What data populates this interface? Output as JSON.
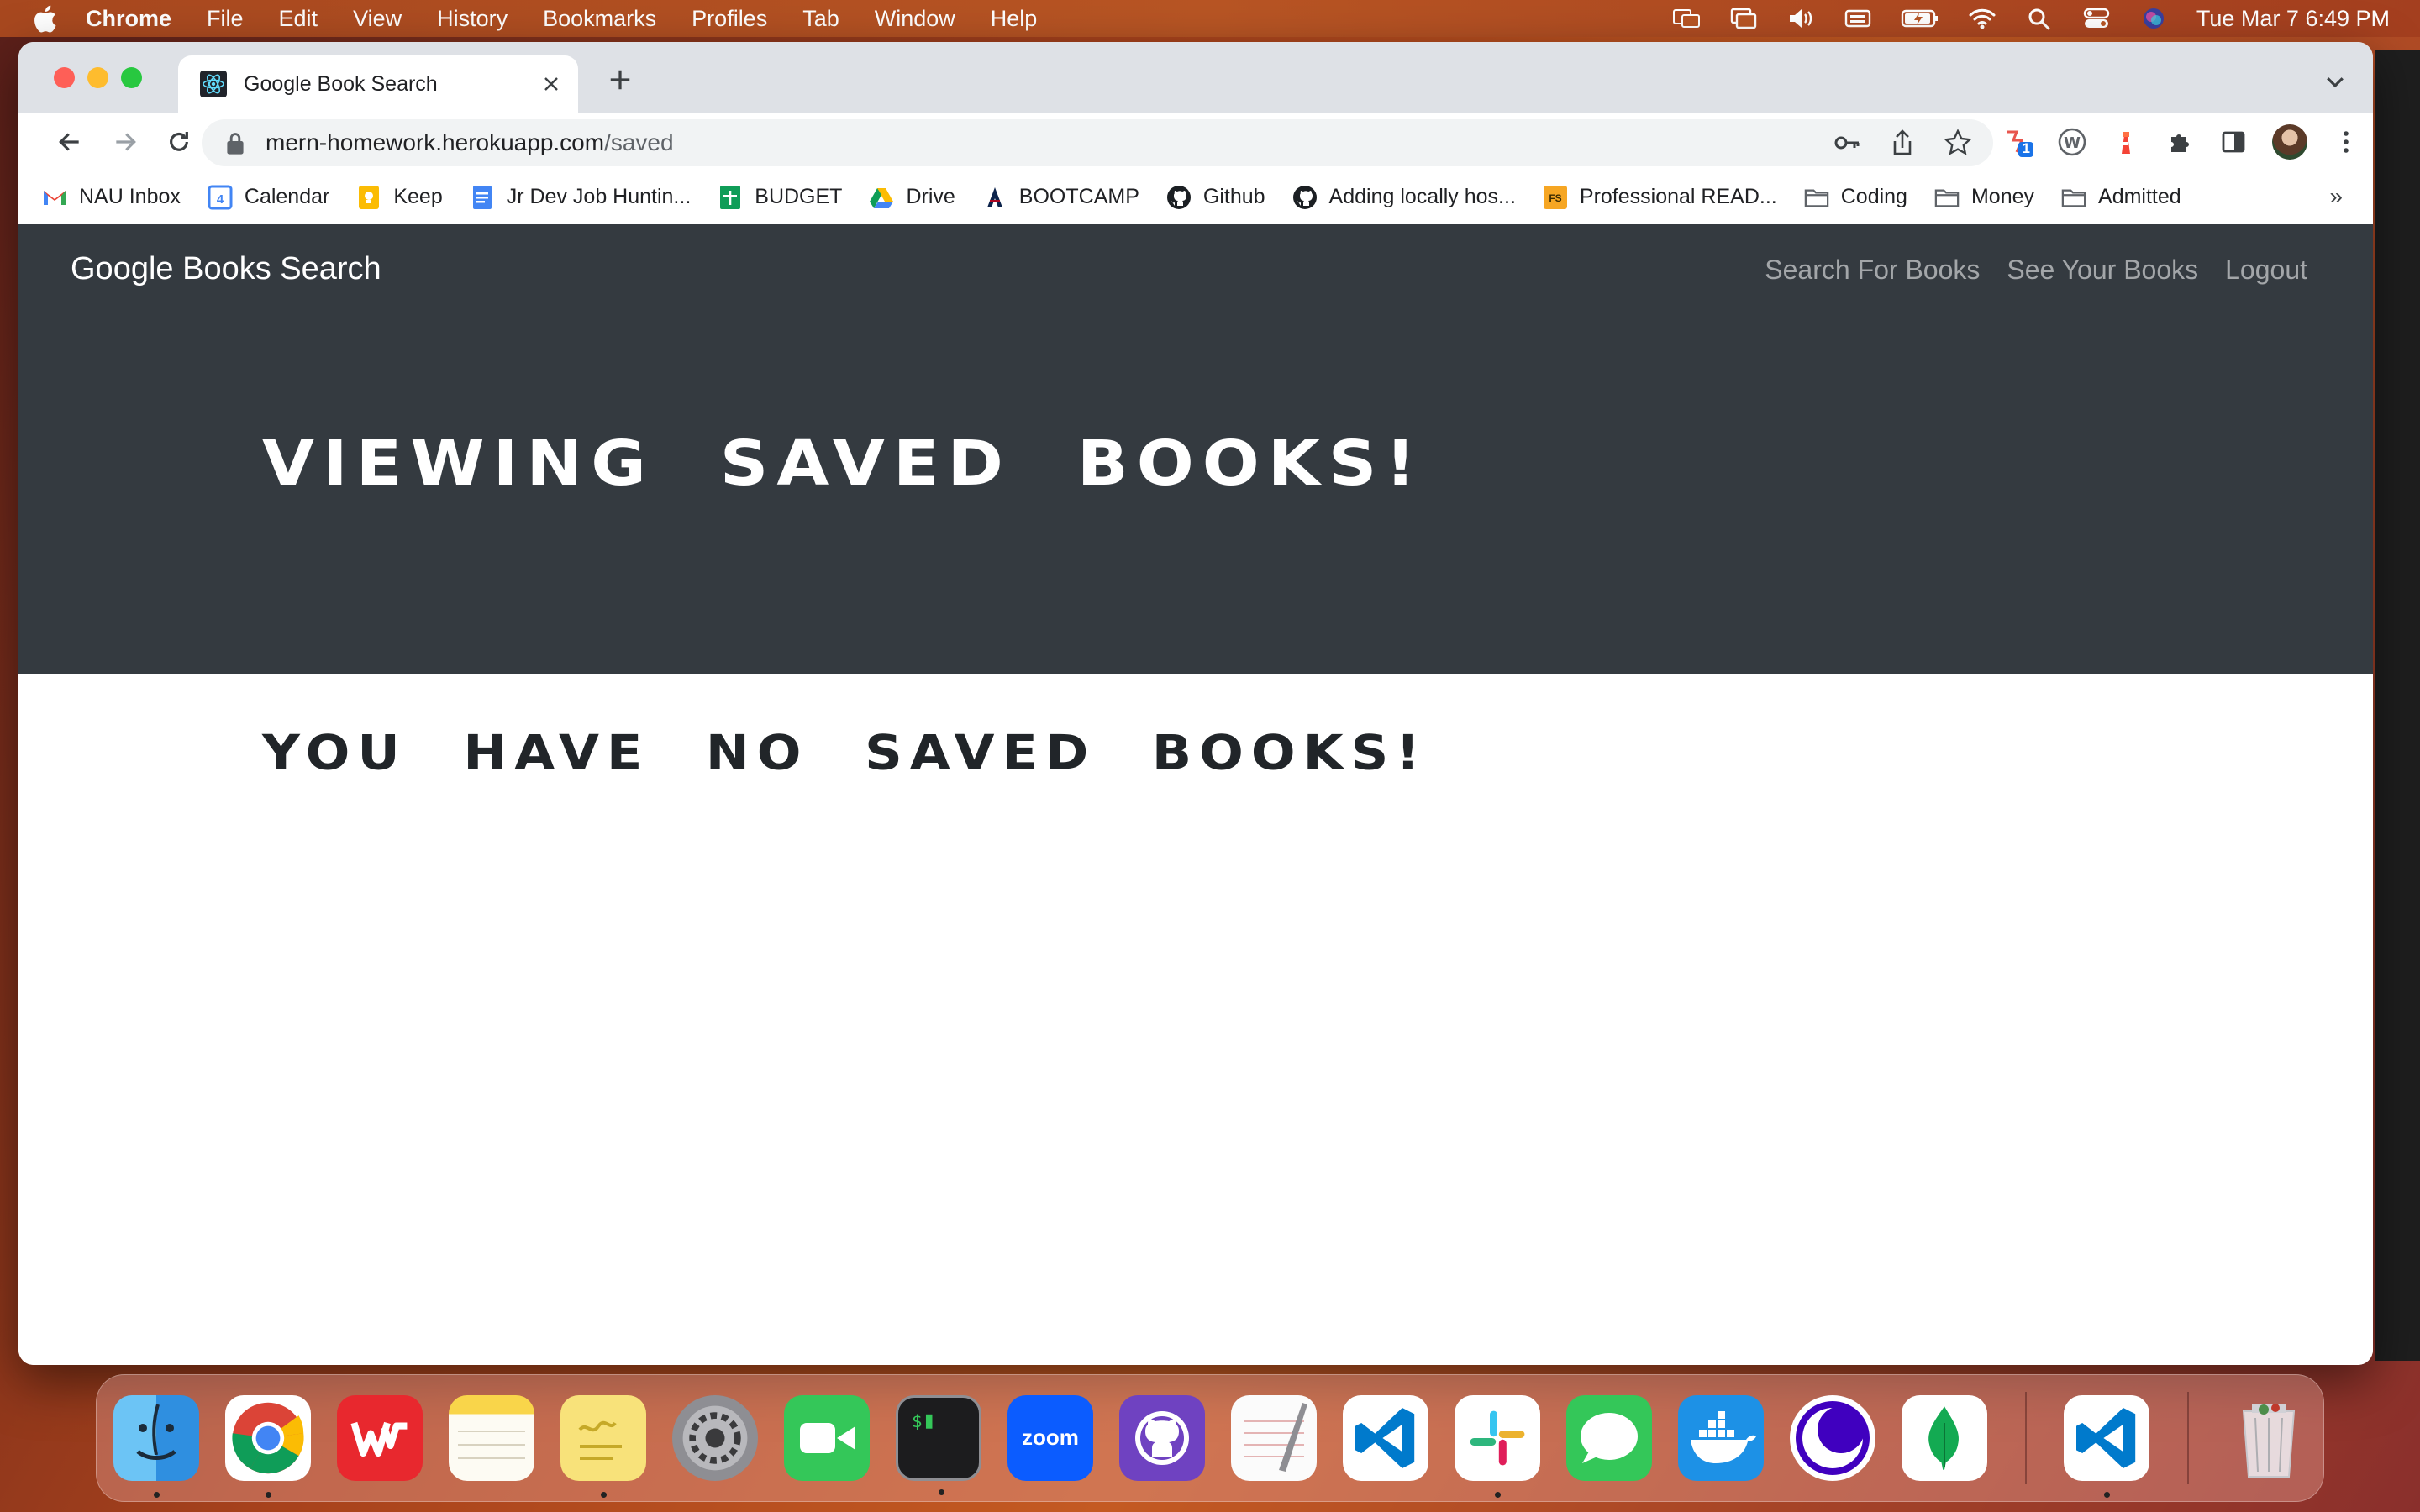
{
  "menubar": {
    "app_name": "Chrome",
    "items": [
      "File",
      "Edit",
      "View",
      "History",
      "Bookmarks",
      "Profiles",
      "Tab",
      "Window",
      "Help"
    ],
    "clock": "Tue Mar 7  6:49 PM"
  },
  "browser": {
    "tab_title": "Google Book Search",
    "url_host": "mern-homework.herokuapp.com",
    "url_path": "/saved",
    "bookmarks": [
      {
        "label": "NAU Inbox",
        "icon": "gmail-icon"
      },
      {
        "label": "Calendar",
        "icon": "calendar-icon"
      },
      {
        "label": "Keep",
        "icon": "keep-icon"
      },
      {
        "label": "Jr Dev Job Huntin...",
        "icon": "docs-icon"
      },
      {
        "label": "BUDGET",
        "icon": "sheets-icon"
      },
      {
        "label": "Drive",
        "icon": "drive-icon"
      },
      {
        "label": "BOOTCAMP",
        "icon": "arizona-icon"
      },
      {
        "label": "Github",
        "icon": "github-icon"
      },
      {
        "label": "Adding locally hos...",
        "icon": "github-icon"
      },
      {
        "label": "Professional READ...",
        "icon": "fs-icon"
      },
      {
        "label": "Coding",
        "icon": "folder-icon"
      },
      {
        "label": "Money",
        "icon": "folder-icon"
      },
      {
        "label": "Admitted",
        "icon": "folder-icon"
      }
    ],
    "bookmarks_more": "»",
    "extension_badge": "1"
  },
  "app": {
    "brand": "Google Books Search",
    "nav": {
      "search": "Search For Books",
      "saved": "See Your Books",
      "logout": "Logout"
    },
    "jumbotron_title": "Viewing saved books!",
    "empty_message": "You have no saved books!"
  },
  "dock": {
    "apps": [
      "Finder",
      "Chrome",
      "WPS Office",
      "Notes",
      "Stickies",
      "System Preferences",
      "FaceTime",
      "Terminal",
      "Zoom",
      "GitHub Desktop",
      "TextEdit",
      "VS Code",
      "Slack",
      "Messages",
      "Docker",
      "Insomnia",
      "MongoDB Compass",
      "VS Code",
      "Trash"
    ]
  },
  "colors": {
    "navbar_bg": "#343a40",
    "nav_link": "rgba(255,255,255,0.55)",
    "heading_dark": "#212529"
  }
}
